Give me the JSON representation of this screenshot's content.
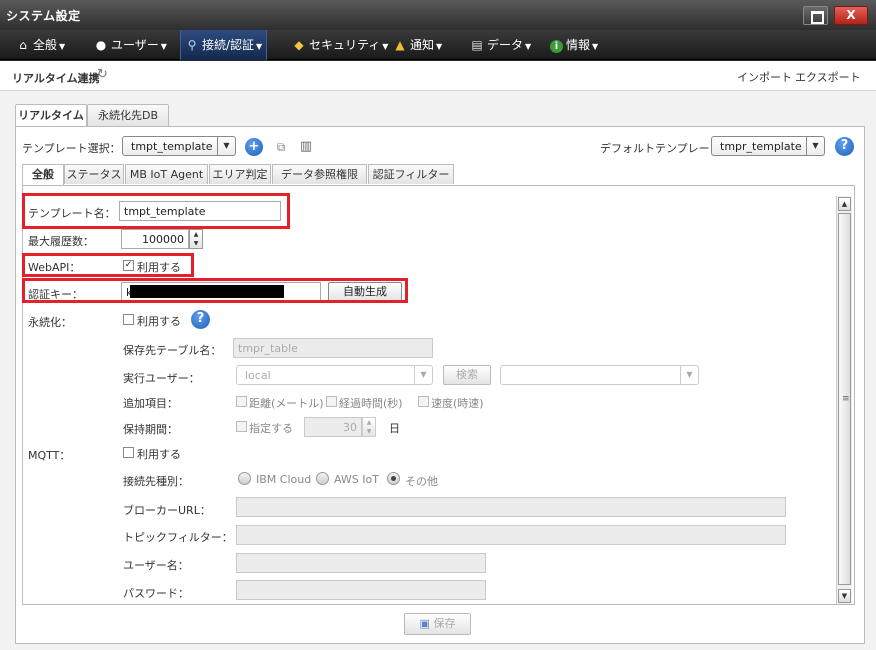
{
  "window": {
    "title": "システム設定",
    "close_label": "X"
  },
  "menu": [
    {
      "label": "全般",
      "icon": "home-icon",
      "glyph": "⌂"
    },
    {
      "label": "ユーザー",
      "icon": "user-icon",
      "glyph": "●"
    },
    {
      "label": "接続/認証",
      "icon": "plug-icon",
      "glyph": "⚲"
    },
    {
      "label": "セキュリティ",
      "icon": "shield-icon",
      "glyph": "◆"
    },
    {
      "label": "通知",
      "icon": "bell-icon",
      "glyph": "▲"
    },
    {
      "label": "データ",
      "icon": "copy-icon",
      "glyph": "▤"
    },
    {
      "label": "情報",
      "icon": "info-icon",
      "glyph": "i"
    }
  ],
  "menu_caret": "▼",
  "header": {
    "title": "リアルタイム連携",
    "import_label": "インポート",
    "export_label": "エクスポート"
  },
  "tabs": [
    {
      "label": "リアルタイム"
    },
    {
      "label": "永続化先DB"
    }
  ],
  "template_select": {
    "label": "テンプレート選択：",
    "value": "tmpt_template"
  },
  "default_template": {
    "label": "デフォルトテンプレート",
    "value": "tmpr_template"
  },
  "help_glyph": "?",
  "subtabs": [
    {
      "label": "全般"
    },
    {
      "label": "ステータス"
    },
    {
      "label": "MB IoT Agent"
    },
    {
      "label": "エリア判定"
    },
    {
      "label": "データ参照権限"
    },
    {
      "label": "認証フィルター"
    }
  ],
  "form": {
    "template_name": {
      "label": "テンプレート名：",
      "value": "tmpt_template"
    },
    "max_history": {
      "label": "最大履歴数：",
      "value": "100000"
    },
    "webapi": {
      "label": "WebAPI：",
      "check_label": "利用する"
    },
    "auth_key": {
      "label": "認証キー：",
      "value": "k",
      "button": "自動生成"
    },
    "persist": {
      "label": "永続化：",
      "check_label": "利用する",
      "table_label": "保存先テーブル名：",
      "table_value": "tmpr_table",
      "exec_user_label": "実行ユーザー：",
      "exec_user_value": "local",
      "search_button": "検索",
      "extra_label": "追加項目：",
      "extra_options": [
        "距離(メートル)",
        "経過時間(秒)",
        "速度(時速)"
      ],
      "period_label": "保持期間：",
      "period_check_label": "指定する",
      "period_value": "30",
      "period_unit": "日"
    },
    "mqtt": {
      "label": "MQTT：",
      "check_label": "利用する",
      "dest_label": "接続先種別：",
      "dest_options": [
        "IBM Cloud",
        "AWS IoT",
        "その他"
      ],
      "broker_label": "ブローカーURL：",
      "topic_label": "トピックフィルター：",
      "user_label": "ユーザー名：",
      "password_label": "パスワード："
    }
  },
  "save_button": "保存"
}
